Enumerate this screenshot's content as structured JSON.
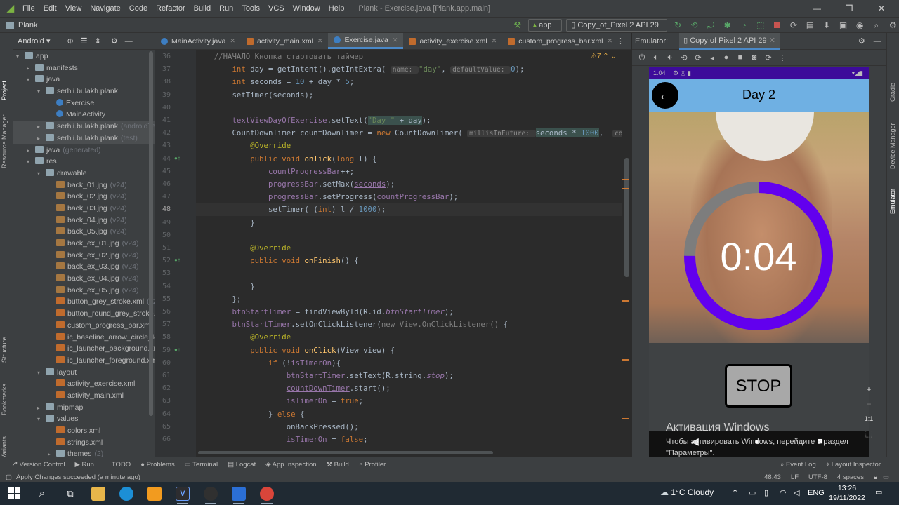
{
  "menubar": {
    "items": [
      "File",
      "Edit",
      "View",
      "Navigate",
      "Code",
      "Refactor",
      "Build",
      "Run",
      "Tools",
      "VCS",
      "Window",
      "Help"
    ],
    "title": "Plank - Exercise.java [Plank.app.main]"
  },
  "navbar": {
    "project": "Plank",
    "run_config": "app",
    "device": "Copy_of_Pixel 2 API 29"
  },
  "left_strip": [
    "Project",
    "Resource Manager",
    "Structure",
    "Bookmarks",
    "Build Variants"
  ],
  "right_strip": [
    "Gradle",
    "Device Manager",
    "Emulator"
  ],
  "project_panel": {
    "view_mode": "Android",
    "tree": [
      {
        "label": "app",
        "hint": "",
        "icon": "folder",
        "level": 0,
        "arrow": "▾"
      },
      {
        "label": "manifests",
        "hint": "",
        "icon": "folder",
        "level": 1,
        "arrow": "▸"
      },
      {
        "label": "java",
        "hint": "",
        "icon": "folder",
        "level": 1,
        "arrow": "▾"
      },
      {
        "label": "serhii.bulakh.plank",
        "hint": "",
        "icon": "folder",
        "level": 2,
        "arrow": "▾"
      },
      {
        "label": "Exercise",
        "hint": "",
        "icon": "java",
        "level": 3,
        "arrow": ""
      },
      {
        "label": "MainActivity",
        "hint": "",
        "icon": "java",
        "level": 3,
        "arrow": ""
      },
      {
        "label": "serhii.bulakh.plank",
        "hint": "(androidTest)",
        "icon": "folder",
        "level": 2,
        "arrow": "▸",
        "sel": true
      },
      {
        "label": "serhii.bulakh.plank",
        "hint": "(test)",
        "icon": "folder",
        "level": 2,
        "arrow": "▸",
        "sel": true
      },
      {
        "label": "java",
        "hint": "(generated)",
        "icon": "folder",
        "level": 1,
        "arrow": "▸"
      },
      {
        "label": "res",
        "hint": "",
        "icon": "folder",
        "level": 1,
        "arrow": "▾"
      },
      {
        "label": "drawable",
        "hint": "",
        "icon": "folder",
        "level": 2,
        "arrow": "▾"
      },
      {
        "label": "back_01.jpg",
        "hint": "(v24)",
        "icon": "img",
        "level": 3,
        "arrow": ""
      },
      {
        "label": "back_02.jpg",
        "hint": "(v24)",
        "icon": "img",
        "level": 3,
        "arrow": ""
      },
      {
        "label": "back_03.jpg",
        "hint": "(v24)",
        "icon": "img",
        "level": 3,
        "arrow": ""
      },
      {
        "label": "back_04.jpg",
        "hint": "(v24)",
        "icon": "img",
        "level": 3,
        "arrow": ""
      },
      {
        "label": "back_05.jpg",
        "hint": "(v24)",
        "icon": "img",
        "level": 3,
        "arrow": ""
      },
      {
        "label": "back_ex_01.jpg",
        "hint": "(v24)",
        "icon": "img",
        "level": 3,
        "arrow": ""
      },
      {
        "label": "back_ex_02.jpg",
        "hint": "(v24)",
        "icon": "img",
        "level": 3,
        "arrow": ""
      },
      {
        "label": "back_ex_03.jpg",
        "hint": "(v24)",
        "icon": "img",
        "level": 3,
        "arrow": ""
      },
      {
        "label": "back_ex_04.jpg",
        "hint": "(v24)",
        "icon": "img",
        "level": 3,
        "arrow": ""
      },
      {
        "label": "back_ex_05.jpg",
        "hint": "(v24)",
        "icon": "img",
        "level": 3,
        "arrow": ""
      },
      {
        "label": "button_grey_stroke.xml",
        "hint": "(v24)",
        "icon": "xml",
        "level": 3,
        "arrow": ""
      },
      {
        "label": "button_round_grey_stroke.xml",
        "hint": "",
        "icon": "xml",
        "level": 3,
        "arrow": ""
      },
      {
        "label": "custom_progress_bar.xml",
        "hint": "",
        "icon": "xml",
        "level": 3,
        "arrow": ""
      },
      {
        "label": "ic_baseline_arrow_circle_left",
        "hint": "",
        "icon": "xml",
        "level": 3,
        "arrow": ""
      },
      {
        "label": "ic_launcher_background.xml",
        "hint": "",
        "icon": "xml",
        "level": 3,
        "arrow": ""
      },
      {
        "label": "ic_launcher_foreground.xml",
        "hint": "",
        "icon": "xml",
        "level": 3,
        "arrow": ""
      },
      {
        "label": "layout",
        "hint": "",
        "icon": "folder",
        "level": 2,
        "arrow": "▾"
      },
      {
        "label": "activity_exercise.xml",
        "hint": "",
        "icon": "xml",
        "level": 3,
        "arrow": ""
      },
      {
        "label": "activity_main.xml",
        "hint": "",
        "icon": "xml",
        "level": 3,
        "arrow": ""
      },
      {
        "label": "mipmap",
        "hint": "",
        "icon": "folder",
        "level": 2,
        "arrow": "▸"
      },
      {
        "label": "values",
        "hint": "",
        "icon": "folder",
        "level": 2,
        "arrow": "▾"
      },
      {
        "label": "colors.xml",
        "hint": "",
        "icon": "xml",
        "level": 3,
        "arrow": ""
      },
      {
        "label": "strings.xml",
        "hint": "",
        "icon": "xml",
        "level": 3,
        "arrow": ""
      },
      {
        "label": "themes",
        "hint": "(2)",
        "icon": "folder",
        "level": 3,
        "arrow": "▸"
      }
    ]
  },
  "editor_tabs": [
    {
      "label": "MainActivity.java",
      "icon": "java",
      "active": false
    },
    {
      "label": "activity_main.xml",
      "icon": "xml",
      "active": false
    },
    {
      "label": "Exercise.java",
      "icon": "java",
      "active": true
    },
    {
      "label": "activity_exercise.xml",
      "icon": "xml",
      "active": false
    },
    {
      "label": "custom_progress_bar.xml",
      "icon": "xml",
      "active": false
    }
  ],
  "editor": {
    "warnings": "⚠7",
    "lines": [
      {
        "n": "36",
        "html": "    <span class=\"cm\">//НАЧАЛО Кнопка стартовать таймер</span>"
      },
      {
        "n": "37",
        "html": "        <span class=\"kw\">int</span> day = getIntent().getIntExtra( <span class=\"hint2\">name: </span><span class=\"str\">\"day\"</span>, <span class=\"hint2\">defaultValue: </span><span class=\"num\">0</span>);"
      },
      {
        "n": "38",
        "html": "        <span class=\"kw\">int</span> seconds = <span class=\"num\">10</span> + day * <span class=\"num\">5</span>;"
      },
      {
        "n": "39",
        "html": "        setTimer(seconds);"
      },
      {
        "n": "40",
        "html": ""
      },
      {
        "n": "41",
        "html": "        <span class=\"fld\">textViewDayOfExercise</span>.setText(<span class=\"hl\"><span class=\"str\">\"Day \"</span> + day</span>);"
      },
      {
        "n": "42",
        "html": "        CountDownTimer countDownTimer = <span class=\"kw\">new</span> CountDownTimer( <span class=\"hint2\">millisInFuture: </span><span class=\"hl\">seconds * <span class=\"num\">1000</span></span>,  <span class=\"hint2\">countDo</span>"
      },
      {
        "n": "43",
        "html": "            <span class=\"ann\">@Override</span>"
      },
      {
        "n": "44",
        "html": "            <span class=\"kw\">public void</span> <span class=\"fn\">onTick</span>(<span class=\"kw\">long</span> l) {"
      },
      {
        "n": "45",
        "html": "                <span class=\"fld\">countProgressBar</span>++;"
      },
      {
        "n": "46",
        "html": "                <span class=\"fld\">progressBar</span>.setMax(<span class=\"fld ul\">seconds</span>);"
      },
      {
        "n": "47",
        "html": "                <span class=\"fld\">progressBar</span>.setProgress(<span class=\"fld\">countProgressBar</span>);"
      },
      {
        "n": "48",
        "html": "                setTimer( (<span class=\"kw\">int</span>) l / <span class=\"num\">1000</span>);",
        "cur": true
      },
      {
        "n": "49",
        "html": "            }"
      },
      {
        "n": "50",
        "html": ""
      },
      {
        "n": "51",
        "html": "            <span class=\"ann\">@Override</span>"
      },
      {
        "n": "52",
        "html": "            <span class=\"kw\">public void</span> <span class=\"fn\">onFinish</span>() {"
      },
      {
        "n": "53",
        "html": ""
      },
      {
        "n": "54",
        "html": "            }"
      },
      {
        "n": "55",
        "html": "        };"
      },
      {
        "n": "56",
        "html": "        <span class=\"fld\">btnStartTimer</span> = findViewById(R.id.<span class=\"fld ita\">btnStartTimer</span>);"
      },
      {
        "n": "57",
        "html": "        <span class=\"fld\">btnStartTimer</span>.setOnClickListener(<span class=\"cm\">new View.OnClickListener()</span> {"
      },
      {
        "n": "58",
        "html": "            <span class=\"ann\">@Override</span>"
      },
      {
        "n": "59",
        "html": "            <span class=\"kw\">public void</span> <span class=\"fn\">onClick</span>(View view) {"
      },
      {
        "n": "60",
        "html": "                <span class=\"kw\">if</span> (!<span class=\"fld\">isTimerOn</span>){"
      },
      {
        "n": "61",
        "html": "                    <span class=\"fld\">btnStartTimer</span>.setText(R.string.<span class=\"fld ita\">stop</span>);"
      },
      {
        "n": "62",
        "html": "                    <span class=\"fld ul\">countDownTimer</span>.start();"
      },
      {
        "n": "63",
        "html": "                    <span class=\"fld\">isTimerOn</span> = <span class=\"kw\">true</span>;"
      },
      {
        "n": "64",
        "html": "                } <span class=\"kw\">else</span> {"
      },
      {
        "n": "65",
        "html": "                    onBackPressed();"
      },
      {
        "n": "66",
        "html": "                    <span class=\"fld\">isTimerOn</span> = <span class=\"kw\">false</span>;"
      }
    ]
  },
  "emulator": {
    "label": "Emulator:",
    "tab": "Copy of Pixel 2 API 29",
    "phone": {
      "clock": "1:04",
      "title": "Day 2",
      "timer": "0:04",
      "progress": 0.75,
      "stop_label": "STOP",
      "watermark_title": "Активация Windows",
      "watermark_text": "Чтобы активировать Windows, перейдите в раздел",
      "watermark_text2": "\"Параметры\"."
    },
    "zoom": "1:1"
  },
  "bottom_tools": [
    "Version Control",
    "Run",
    "TODO",
    "Problems",
    "Terminal",
    "Logcat",
    "App Inspection",
    "Build",
    "Profiler"
  ],
  "bottom_right": [
    "Event Log",
    "Layout Inspector"
  ],
  "status": {
    "message": "Apply Changes succeeded (a minute ago)",
    "position": "48:43",
    "line_sep": "LF",
    "encoding": "UTF-8",
    "indent": "4 spaces"
  },
  "taskbar": {
    "weather": "1°C  Cloudy",
    "lang": "ENG",
    "time": "13:26",
    "date": "19/11/2022",
    "apps": [
      {
        "name": "explorer",
        "color": "#e8b64a"
      },
      {
        "name": "edge",
        "color": "#1c8fd6"
      },
      {
        "name": "sublime",
        "color": "#f29b1f"
      },
      {
        "name": "visual-studio",
        "color": "#2d2d30"
      },
      {
        "name": "obs",
        "color": "#303030"
      },
      {
        "name": "wps",
        "color": "#2b6fd6"
      },
      {
        "name": "chrome",
        "color": "#d9453a"
      }
    ]
  },
  "colors": {
    "ide_bg": "#2b2b2b",
    "progress": "#6200ee",
    "phone_bar": "#6fb0e3",
    "status_bar": "#3d0b9a"
  }
}
